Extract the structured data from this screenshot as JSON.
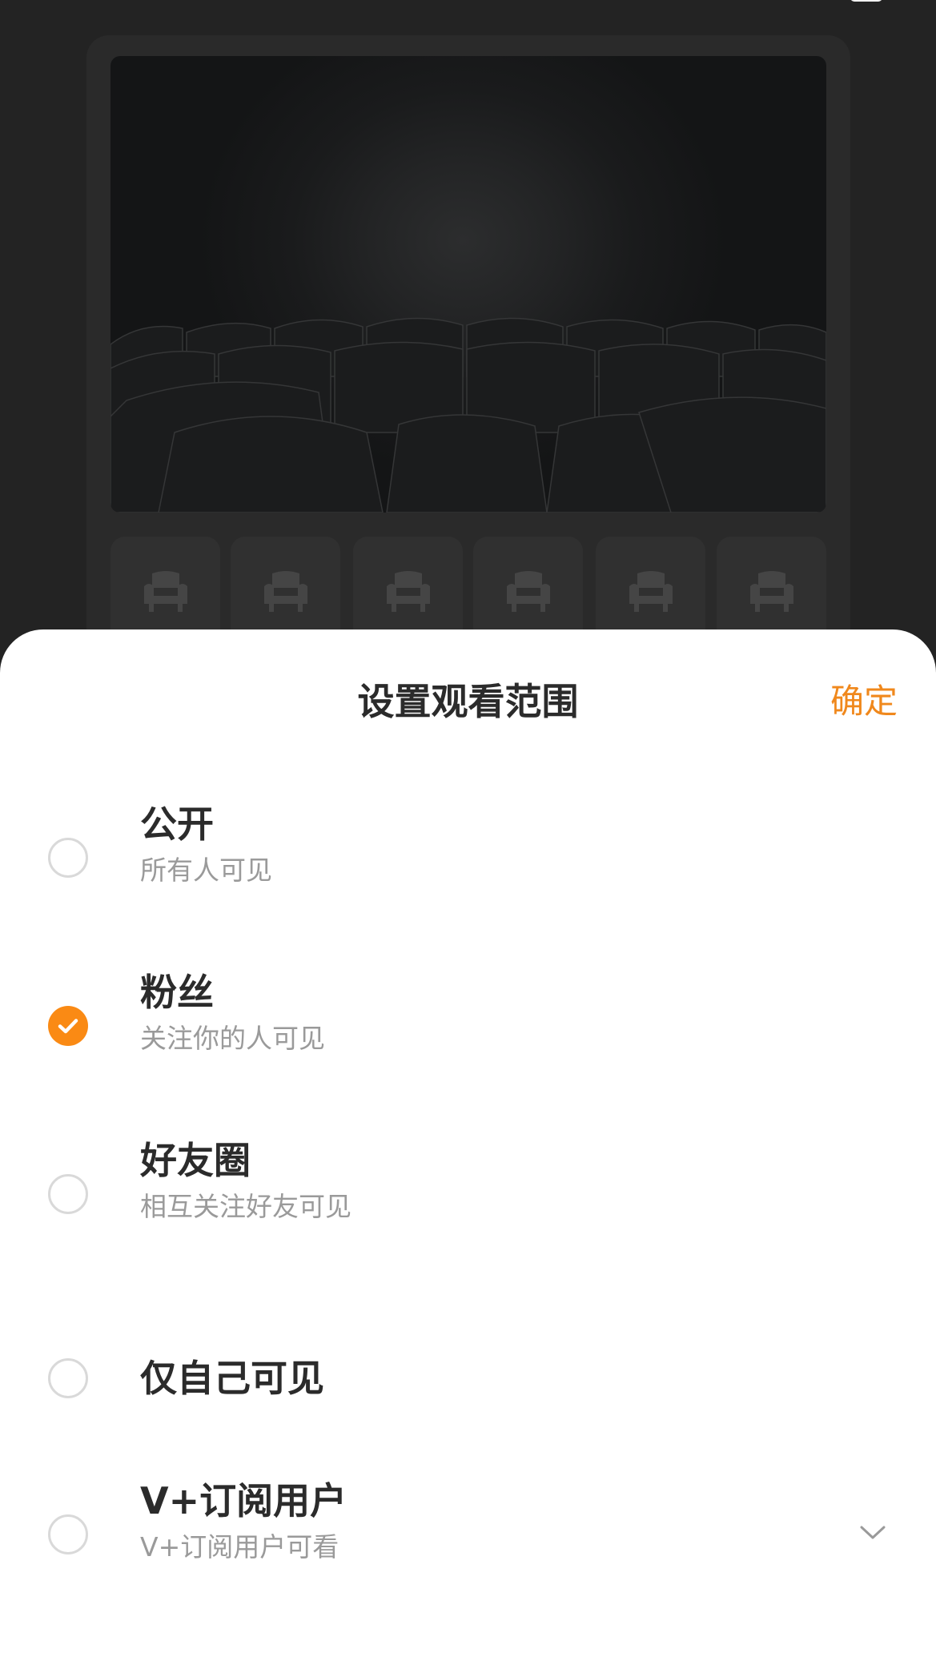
{
  "sheet": {
    "title": "设置观看范围",
    "confirm_label": "确定"
  },
  "options": [
    {
      "title": "公开",
      "description": "所有人可见",
      "selected": false
    },
    {
      "title": "粉丝",
      "description": "关注你的人可见",
      "selected": true
    },
    {
      "title": "好友圈",
      "description": "相互关注好友可见",
      "selected": false
    },
    {
      "title": "仅自己可见",
      "description": "",
      "selected": false
    },
    {
      "title": "V+订阅用户",
      "description": "V+订阅用户可看",
      "selected": false,
      "expandable": true
    }
  ],
  "icons": {
    "check": "check-icon",
    "expand": "chevron-down-icon",
    "seat": "armchair-icon"
  },
  "colors": {
    "accent": "#fa8a14",
    "confirm_text": "#f0881c",
    "title_text": "#2b2b2b",
    "desc_text": "#9a9a9a"
  }
}
